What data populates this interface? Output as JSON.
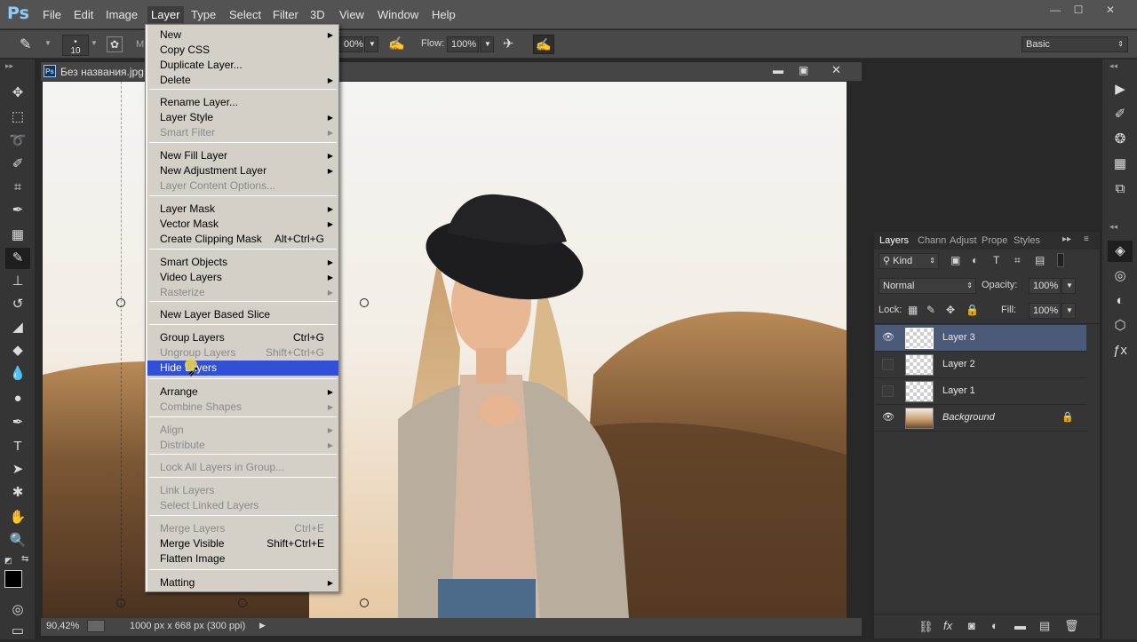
{
  "app": {
    "logo": "Ps"
  },
  "menubar": {
    "items": [
      "File",
      "Edit",
      "Image",
      "Layer",
      "Type",
      "Select",
      "Filter",
      "3D",
      "View",
      "Window",
      "Help"
    ]
  },
  "window_controls": {
    "minimize": "—",
    "restore": "☐",
    "close": "✕"
  },
  "optionsbar": {
    "brush_size": "10",
    "mode_short": "M",
    "opacity_value": "00%",
    "flow_label": "Flow:",
    "flow_value": "100%",
    "workspace": "Basic"
  },
  "document": {
    "tab_title": "Без названия.jpg",
    "zoom": "90,42%",
    "info": "1000 px x 668 px (300 ppi)"
  },
  "layer_menu": [
    {
      "label": "New",
      "shortcut": "",
      "arrow": true,
      "disabled": false
    },
    {
      "label": "Copy CSS",
      "shortcut": "",
      "arrow": false,
      "disabled": false
    },
    {
      "label": "Duplicate Layer...",
      "shortcut": "",
      "arrow": false,
      "disabled": false
    },
    {
      "label": "Delete",
      "shortcut": "",
      "arrow": true,
      "disabled": false
    },
    {
      "label": "Rename Layer...",
      "shortcut": "",
      "arrow": false,
      "disabled": false
    },
    {
      "label": "Layer Style",
      "shortcut": "",
      "arrow": true,
      "disabled": false
    },
    {
      "label": "Smart Filter",
      "shortcut": "",
      "arrow": true,
      "disabled": true
    },
    {
      "label": "New Fill Layer",
      "shortcut": "",
      "arrow": true,
      "disabled": false
    },
    {
      "label": "New Adjustment Layer",
      "shortcut": "",
      "arrow": true,
      "disabled": false
    },
    {
      "label": "Layer Content Options...",
      "shortcut": "",
      "arrow": false,
      "disabled": true
    },
    {
      "label": "Layer Mask",
      "shortcut": "",
      "arrow": true,
      "disabled": false
    },
    {
      "label": "Vector Mask",
      "shortcut": "",
      "arrow": true,
      "disabled": false
    },
    {
      "label": "Create Clipping Mask",
      "shortcut": "Alt+Ctrl+G",
      "arrow": false,
      "disabled": false
    },
    {
      "label": "Smart Objects",
      "shortcut": "",
      "arrow": true,
      "disabled": false
    },
    {
      "label": "Video Layers",
      "shortcut": "",
      "arrow": true,
      "disabled": false
    },
    {
      "label": "Rasterize",
      "shortcut": "",
      "arrow": true,
      "disabled": true
    },
    {
      "label": "New Layer Based Slice",
      "shortcut": "",
      "arrow": false,
      "disabled": false
    },
    {
      "label": "Group Layers",
      "shortcut": "Ctrl+G",
      "arrow": false,
      "disabled": false
    },
    {
      "label": "Ungroup Layers",
      "shortcut": "Shift+Ctrl+G",
      "arrow": false,
      "disabled": true
    },
    {
      "label": "Hide Layers",
      "shortcut": "",
      "arrow": false,
      "disabled": false,
      "highlighted": true
    },
    {
      "label": "Arrange",
      "shortcut": "",
      "arrow": true,
      "disabled": false
    },
    {
      "label": "Combine Shapes",
      "shortcut": "",
      "arrow": true,
      "disabled": true
    },
    {
      "label": "Align",
      "shortcut": "",
      "arrow": true,
      "disabled": true
    },
    {
      "label": "Distribute",
      "shortcut": "",
      "arrow": true,
      "disabled": true
    },
    {
      "label": "Lock All Layers in Group...",
      "shortcut": "",
      "arrow": false,
      "disabled": true
    },
    {
      "label": "Link Layers",
      "shortcut": "",
      "arrow": false,
      "disabled": true
    },
    {
      "label": "Select Linked Layers",
      "shortcut": "",
      "arrow": false,
      "disabled": true
    },
    {
      "label": "Merge Layers",
      "shortcut": "Ctrl+E",
      "arrow": false,
      "disabled": true
    },
    {
      "label": "Merge Visible",
      "shortcut": "Shift+Ctrl+E",
      "arrow": false,
      "disabled": false
    },
    {
      "label": "Flatten Image",
      "shortcut": "",
      "arrow": false,
      "disabled": false
    },
    {
      "label": "Matting",
      "shortcut": "",
      "arrow": true,
      "disabled": false
    }
  ],
  "layers_panel": {
    "tabs": [
      "Layers",
      "Chann",
      "Adjust",
      "Prope",
      "Styles"
    ],
    "filter_kind": "Kind",
    "blend_mode": "Normal",
    "opacity_label": "Opacity:",
    "opacity_value": "100%",
    "lock_label": "Lock:",
    "fill_label": "Fill:",
    "fill_value": "100%",
    "layers": [
      {
        "name": "Layer 3",
        "visible": true,
        "selected": true
      },
      {
        "name": "Layer 2",
        "visible": false,
        "selected": false
      },
      {
        "name": "Layer 1",
        "visible": false,
        "selected": false
      },
      {
        "name": "Background",
        "visible": true,
        "selected": false,
        "locked": true
      }
    ]
  },
  "colors": {
    "menu_highlight": "#3150d6",
    "selected_layer": "#4b5a78",
    "ui_bg": "#535353"
  }
}
